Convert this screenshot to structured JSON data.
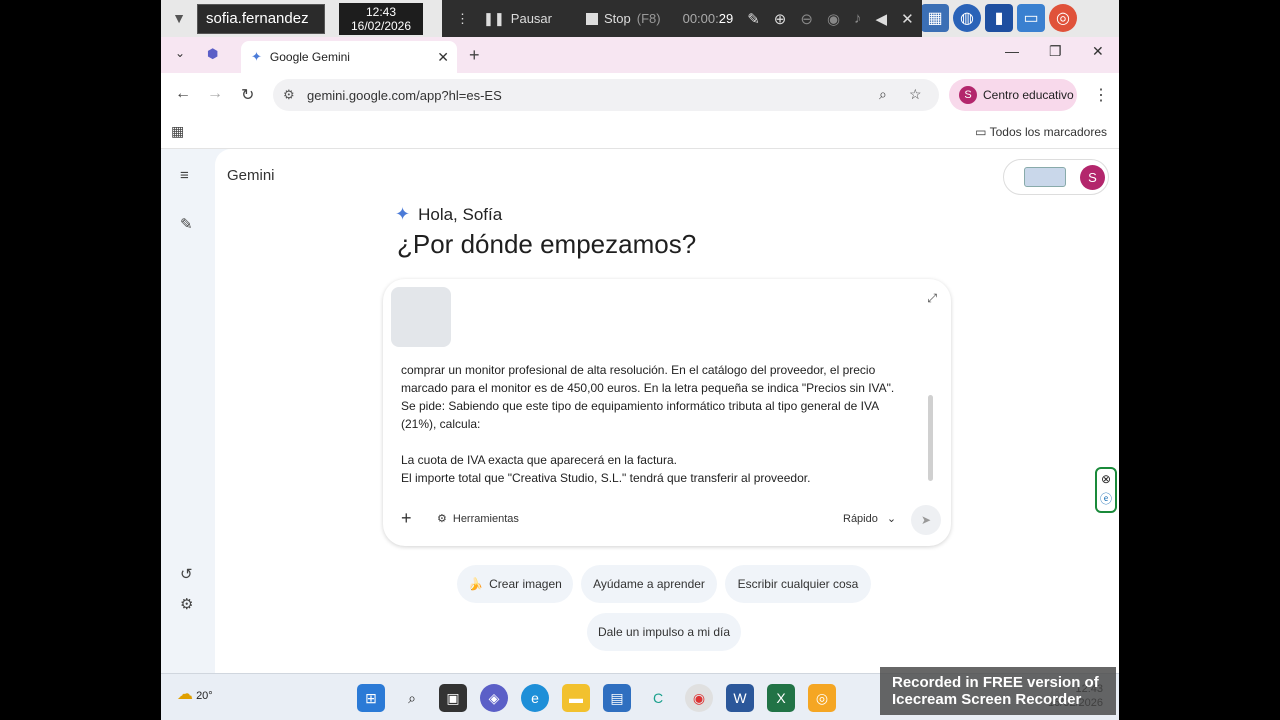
{
  "session": {
    "username": "sofia.fernandez",
    "time": "12:43",
    "date": "16/02/2026"
  },
  "recorder": {
    "pause_label": "Pausar",
    "stop_label": "Stop",
    "stop_shortcut": "(F8)",
    "timer_prefix": "00:00:",
    "timer_seconds": "29"
  },
  "browser": {
    "tab_title": "Google Gemini",
    "url": "gemini.google.com/app?hl=es-ES",
    "profile_label": "Centro educativo",
    "profile_initial": "S",
    "bookmarks_label": "Todos los marcadores"
  },
  "gemini": {
    "app_title": "Gemini",
    "account_initial": "S",
    "greeting": "Hola, Sofía",
    "headline": "¿Por dónde empezamos?",
    "prompt_lines": [
      "comprar un monitor profesional de alta resolución. En el catálogo del proveedor, el precio",
      "marcado para el monitor es de 450,00 euros. En la letra pequeña se indica \"Precios sin IVA\".",
      "Se pide: Sabiendo que este tipo de equipamiento informático tributa al tipo general de IVA",
      "(21%), calcula:"
    ],
    "prompt_lines_2": [
      "La cuota de IVA exacta que aparecerá en la factura.",
      "El importe total que \"Creativa Studio, S.L.\" tendrá que transferir al proveedor."
    ],
    "tools_label": "Herramientas",
    "mode_label": "Rápido",
    "chips": [
      "Crear imagen",
      "Ayúdame a aprender",
      "Escribir cualquier cosa",
      "Dale un impulso a mi día"
    ]
  },
  "taskbar": {
    "temperature": "20°"
  },
  "watermark": {
    "line1": "Recorded in FREE version of",
    "line2": "Icecream  Screen  Recorder"
  }
}
